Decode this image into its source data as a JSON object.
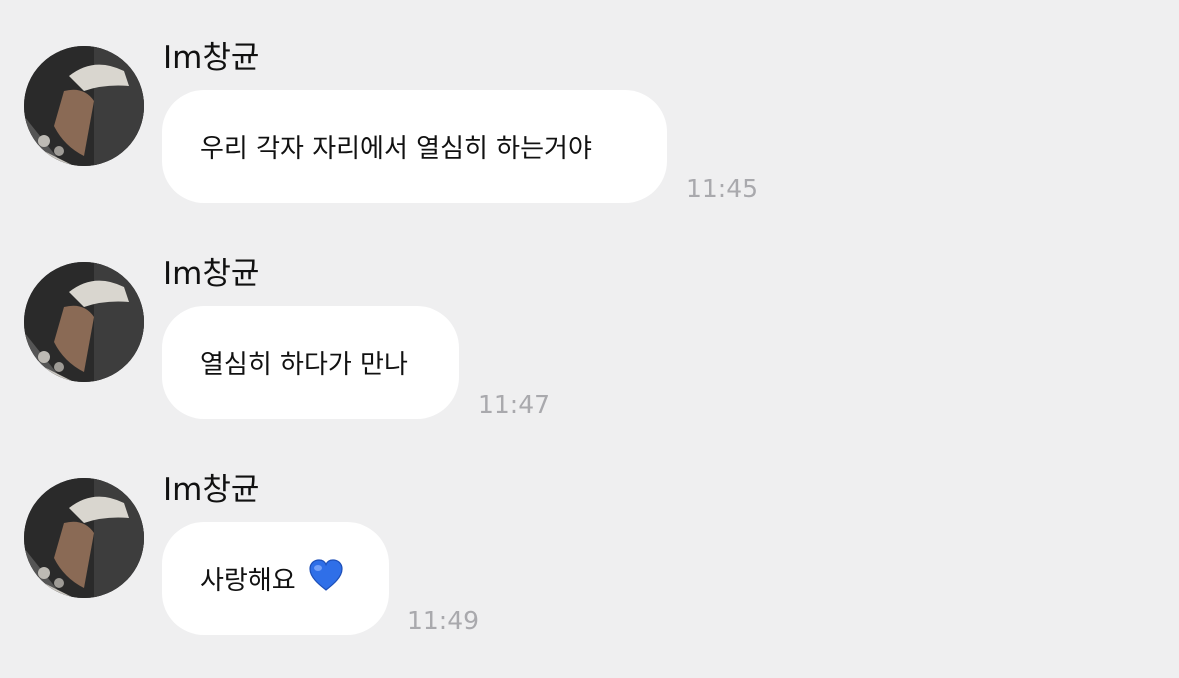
{
  "messages": [
    {
      "sender": "Im창균",
      "text": "우리 각자 자리에서 열심히 하는거야",
      "time": "11:45"
    },
    {
      "sender": "Im창균",
      "text": "열심히 하다가 만나",
      "time": "11:47"
    },
    {
      "sender": "Im창균",
      "text": "사랑해요",
      "emoji": "blue-heart-icon",
      "time": "11:49"
    }
  ],
  "colors": {
    "background": "#efeff0",
    "bubble": "#ffffff",
    "time": "#a9a9ad",
    "heart": "#2f6fe8"
  }
}
